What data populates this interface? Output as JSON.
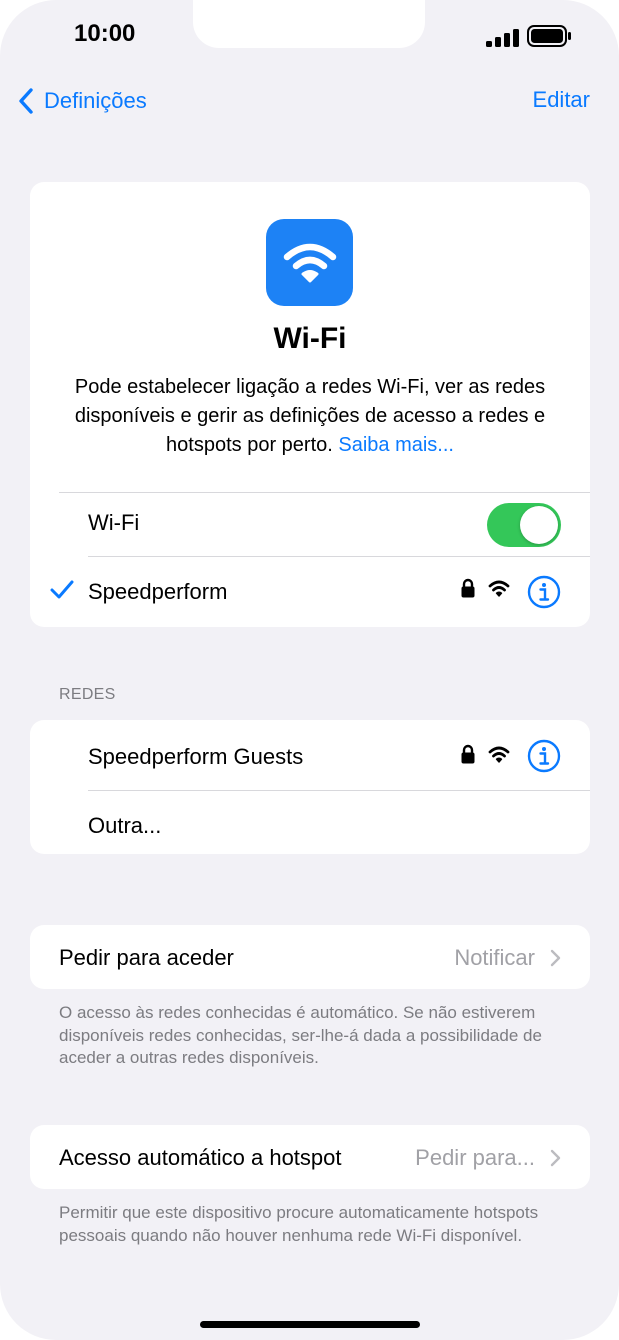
{
  "status_bar": {
    "time": "10:00"
  },
  "nav": {
    "back_label": "Definições",
    "edit_label": "Editar"
  },
  "hero": {
    "title": "Wi-Fi",
    "description": "Pode estabelecer ligação a redes Wi-Fi, ver as redes disponíveis e gerir as definições de acesso a redes e hotspots por perto. ",
    "learn_more": "Saiba mais..."
  },
  "wifi_toggle": {
    "label": "Wi-Fi",
    "on": true
  },
  "connected_network": {
    "name": "Speedperform",
    "secured": true
  },
  "networks": {
    "header": "REDES",
    "items": [
      {
        "name": "Speedperform Guests",
        "secured": true
      },
      {
        "name": "Outra..."
      }
    ]
  },
  "ask_to_join": {
    "label": "Pedir para aceder",
    "value": "Notificar",
    "footnote": "O acesso às redes conhecidas é automático. Se não estiverem disponíveis redes conhecidas, ser-lhe-á dada a possibilidade de aceder a outras redes disponíveis."
  },
  "auto_hotspot": {
    "label": "Acesso automático a hotspot",
    "value": "Pedir para...",
    "footnote": "Permitir que este dispositivo procure automaticamente hotspots pessoais quando não houver nenhuma rede Wi-Fi disponível."
  },
  "colors": {
    "accent": "#0a7aff",
    "toggle_on": "#34c759",
    "wifi_tile": "#1d82f5",
    "background": "#f2f1f6"
  },
  "icons": [
    "chevron-left-icon",
    "wifi-icon",
    "checkmark-icon",
    "lock-icon",
    "info-icon",
    "chevron-right-icon",
    "cellular-signal-icon",
    "battery-icon"
  ]
}
